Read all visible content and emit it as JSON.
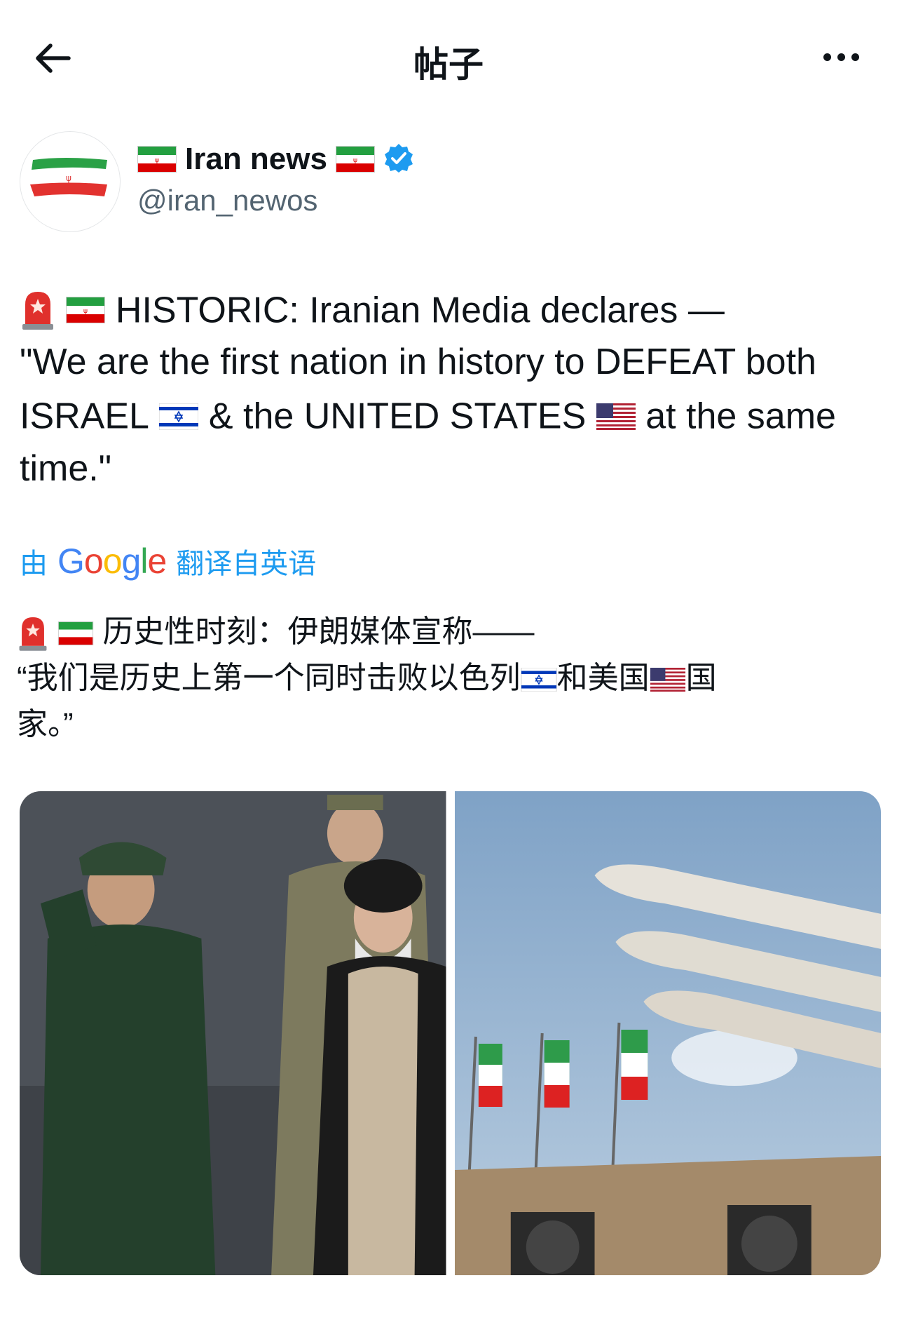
{
  "header": {
    "title": "帖子",
    "back_icon": "arrow-left-icon",
    "more_icon": "more-horizontal-icon"
  },
  "author": {
    "display_name": "Iran news",
    "handle": "@iran_newos",
    "verified": true,
    "verified_color": "#1d9bf0"
  },
  "post": {
    "en_line1": "HISTORIC: Iranian Media declares —",
    "en_line2": "\"We are the first nation in history to DEFEAT both",
    "en_israel": "ISRAEL",
    "en_and_us": "& the UNITED STATES",
    "en_tail": "at the same",
    "en_line4": "time.\"",
    "translate_prefix": "由",
    "translate_brand": "Google",
    "translate_suffix": "翻译自英语",
    "zh_line1": "历史性时刻：伊朗媒体宣称——",
    "zh_line2a": "“我们是历史上第一个同时击败以色列",
    "zh_line2b": "和美国",
    "zh_line2c": "国",
    "zh_line3": "家。”"
  },
  "media": {
    "image_count": 2,
    "images": [
      "photo-military-officials",
      "photo-missiles-and-flags"
    ]
  },
  "colors": {
    "link_blue": "#1d9bf0",
    "text": "#0f1419",
    "secondary": "#536471"
  }
}
